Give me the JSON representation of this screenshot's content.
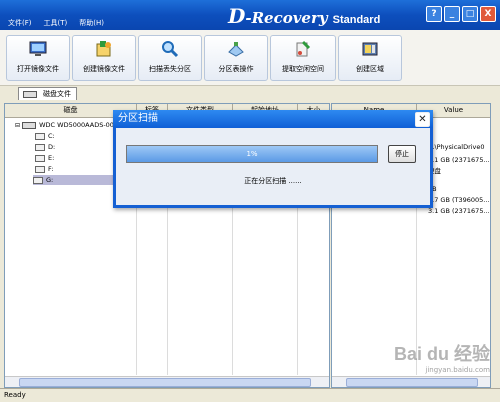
{
  "titlebar": {
    "menus": [
      "文件(F)",
      "工具(T)",
      "帮助(H)"
    ],
    "app_title_prefix": "D",
    "app_title_rest": "-Recovery",
    "app_title_edition": "Standard",
    "window_buttons": [
      "?",
      "_",
      "□",
      "X"
    ]
  },
  "toolbar": {
    "buttons": [
      {
        "label": "打开镜像文件",
        "icon": "monitor-icon"
      },
      {
        "label": "创建镜像文件",
        "icon": "image-create-icon"
      },
      {
        "label": "扫描丢失分区",
        "icon": "magnifier-icon"
      },
      {
        "label": "分区表操作",
        "icon": "partition-table-icon"
      },
      {
        "label": "提取空闲空间",
        "icon": "extract-space-icon"
      },
      {
        "label": "创建区域",
        "icon": "create-region-icon"
      }
    ]
  },
  "tab": {
    "label": "磁盘文件"
  },
  "left_table": {
    "columns": [
      "磁盘",
      "标签",
      "文件类型",
      "起始地址",
      "大小"
    ],
    "rows": [
      {
        "name": "WDC WD5000AADS-00S9B0",
        "selected": false,
        "level": 0
      },
      {
        "name": "C:",
        "selected": false,
        "level": 1
      },
      {
        "name": "D:",
        "selected": false,
        "level": 1
      },
      {
        "name": "E:",
        "selected": false,
        "level": 1
      },
      {
        "name": "F:",
        "selected": false,
        "level": 1
      },
      {
        "name": "G:",
        "selected": true,
        "level": 1
      }
    ]
  },
  "right_table": {
    "columns": [
      "Name",
      "Value"
    ],
    "rows": [
      {
        "name": "",
        "value": ""
      },
      {
        "name": "",
        "value": "\\\\.\\PhysicalDrive0"
      },
      {
        "name": "",
        "value": "3.1 GB (2371675..."
      },
      {
        "name": "",
        "value": "硬盘"
      },
      {
        "name": "",
        "value": ""
      },
      {
        "name": "",
        "value": ""
      },
      {
        "name": "",
        "value": "2B"
      },
      {
        "name": "",
        "value": "2.7 GB (T396005..."
      },
      {
        "name": "",
        "value": "3.1 GB (2371675..."
      }
    ]
  },
  "dialog": {
    "title": "分区扫描",
    "progress_percent": 1,
    "progress_text": "1%",
    "stop_button": "停止",
    "status": "正在分区扫描 ......"
  },
  "statusbar": {
    "text": "Ready"
  },
  "watermark": {
    "logo": "Bai du 经验",
    "sub": "jingyan.baidu.com"
  },
  "colors": {
    "titlebar": "#0d4fbd",
    "dialog_border": "#1560d3",
    "progress_fill": "#5b9ae6",
    "selection": "#b9b9d8"
  }
}
